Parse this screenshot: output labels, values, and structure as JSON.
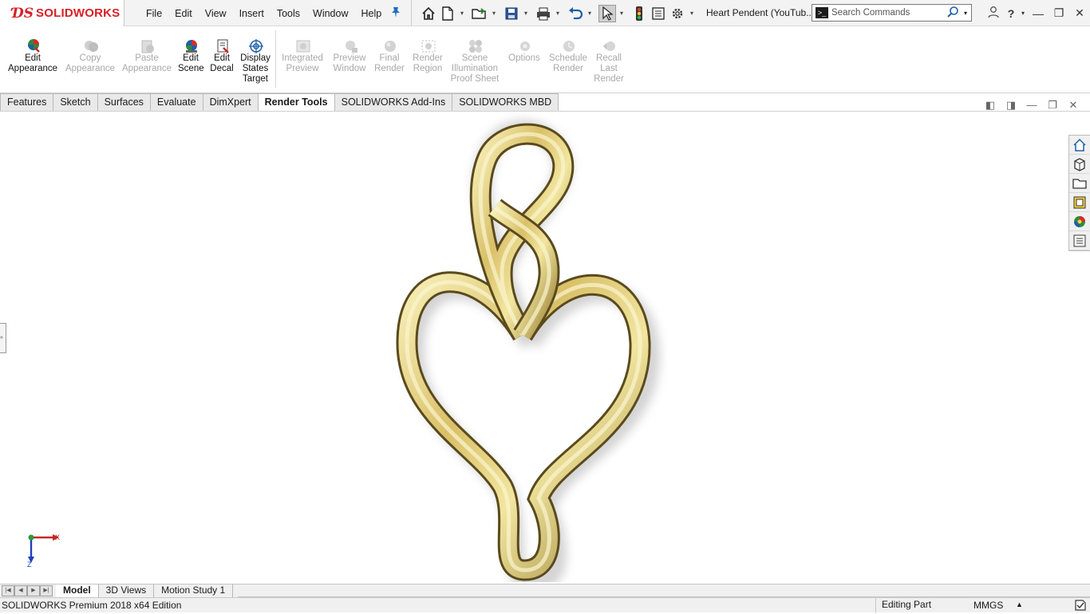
{
  "app": {
    "logo_text": "SOLIDWORKS",
    "document_title": "Heart Pendent (YouTub..."
  },
  "menu": [
    "File",
    "Edit",
    "View",
    "Insert",
    "Tools",
    "Window",
    "Help"
  ],
  "search": {
    "placeholder": "Search Commands"
  },
  "command_manager": {
    "commands": [
      {
        "label": "Edit\nAppearance",
        "enabled": true,
        "icon": "edit-appearance-icon"
      },
      {
        "label": "Copy\nAppearance",
        "enabled": false,
        "icon": "copy-appearance-icon"
      },
      {
        "label": "Paste\nAppearance",
        "enabled": false,
        "icon": "paste-appearance-icon"
      },
      {
        "label": "Edit\nScene",
        "enabled": true,
        "icon": "edit-scene-icon"
      },
      {
        "label": "Edit\nDecal",
        "enabled": true,
        "icon": "edit-decal-icon"
      },
      {
        "label": "Display\nStates\nTarget",
        "enabled": true,
        "icon": "display-states-target-icon"
      },
      {
        "label": "Integrated\nPreview",
        "enabled": false,
        "icon": "integrated-preview-icon"
      },
      {
        "label": "Preview\nWindow",
        "enabled": false,
        "icon": "preview-window-icon"
      },
      {
        "label": "Final\nRender",
        "enabled": false,
        "icon": "final-render-icon"
      },
      {
        "label": "Render\nRegion",
        "enabled": false,
        "icon": "render-region-icon"
      },
      {
        "label": "Scene\nIllumination\nProof Sheet",
        "enabled": false,
        "icon": "scene-illumination-icon"
      },
      {
        "label": "Options",
        "enabled": false,
        "icon": "options-icon"
      },
      {
        "label": "Schedule\nRender",
        "enabled": false,
        "icon": "schedule-render-icon"
      },
      {
        "label": "Recall\nLast\nRender",
        "enabled": false,
        "icon": "recall-last-render-icon"
      }
    ]
  },
  "tabs": [
    {
      "label": "Features",
      "active": false
    },
    {
      "label": "Sketch",
      "active": false
    },
    {
      "label": "Surfaces",
      "active": false
    },
    {
      "label": "Evaluate",
      "active": false
    },
    {
      "label": "DimXpert",
      "active": false
    },
    {
      "label": "Render Tools",
      "active": true
    },
    {
      "label": "SOLIDWORKS Add-Ins",
      "active": false
    },
    {
      "label": "SOLIDWORKS MBD",
      "active": false
    }
  ],
  "triad": {
    "x_label": "X",
    "z_label": "Z"
  },
  "bottom_tabs": [
    {
      "label": "Model",
      "active": true
    },
    {
      "label": "3D Views",
      "active": false
    },
    {
      "label": "Motion Study 1",
      "active": false
    }
  ],
  "status": {
    "edition": "SOLIDWORKS Premium 2018 x64 Edition",
    "mode": "Editing Part",
    "units": "MMGS"
  },
  "colors": {
    "brand_red": "#d82027",
    "gold_light": "#f4eaa6",
    "gold_mid": "#c9ad4f",
    "gold_dark": "#6b5a22"
  }
}
